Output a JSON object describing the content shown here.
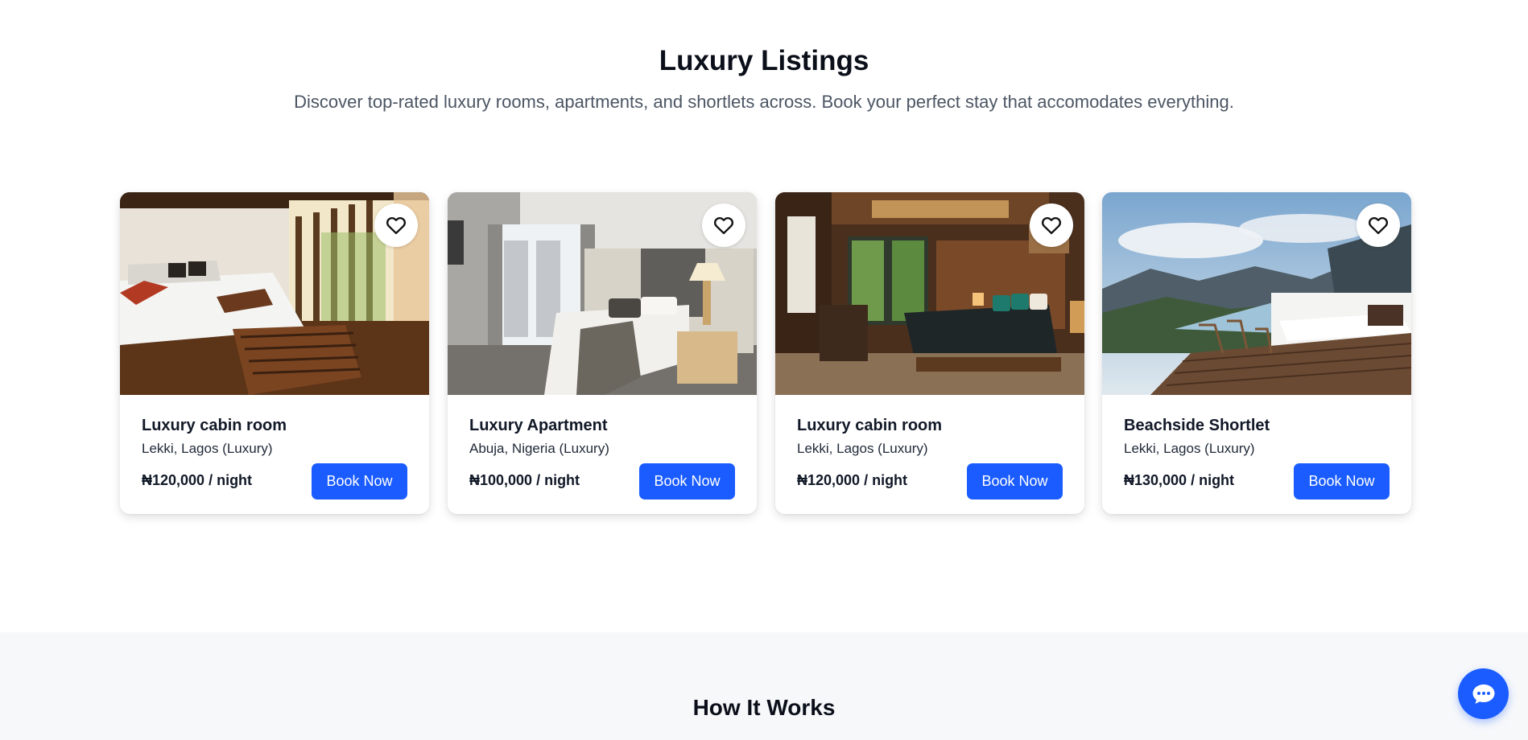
{
  "listings_section": {
    "title": "Luxury Listings",
    "subtitle": "Discover top-rated luxury rooms, apartments, and shortlets across. Book your perfect stay that accomodates everything."
  },
  "listings": [
    {
      "title": "Luxury cabin room",
      "location": "Lekki, Lagos (Luxury)",
      "price": "₦120,000 / night",
      "book_label": "Book Now",
      "image": "cabin-bedroom-photo"
    },
    {
      "title": "Luxury Apartment",
      "location": "Abuja, Nigeria (Luxury)",
      "price": "₦100,000 / night",
      "book_label": "Book Now",
      "image": "apartment-bedroom-photo"
    },
    {
      "title": "Luxury cabin room",
      "location": "Lekki, Lagos (Luxury)",
      "price": "₦120,000 / night",
      "book_label": "Book Now",
      "image": "wooden-bedroom-photo"
    },
    {
      "title": "Beachside Shortlet",
      "location": "Lekki, Lagos (Luxury)",
      "price": "₦130,000 / night",
      "book_label": "Book Now",
      "image": "mountain-view-bed-photo"
    }
  ],
  "how_it_works": {
    "title": "How It Works"
  },
  "icons": {
    "favorite": "heart-outline-icon",
    "chat": "chat-bubble-icon"
  },
  "colors": {
    "accent": "#1a5cff",
    "section_alt_bg": "#f7f8fa",
    "subtitle": "#4b5563"
  }
}
